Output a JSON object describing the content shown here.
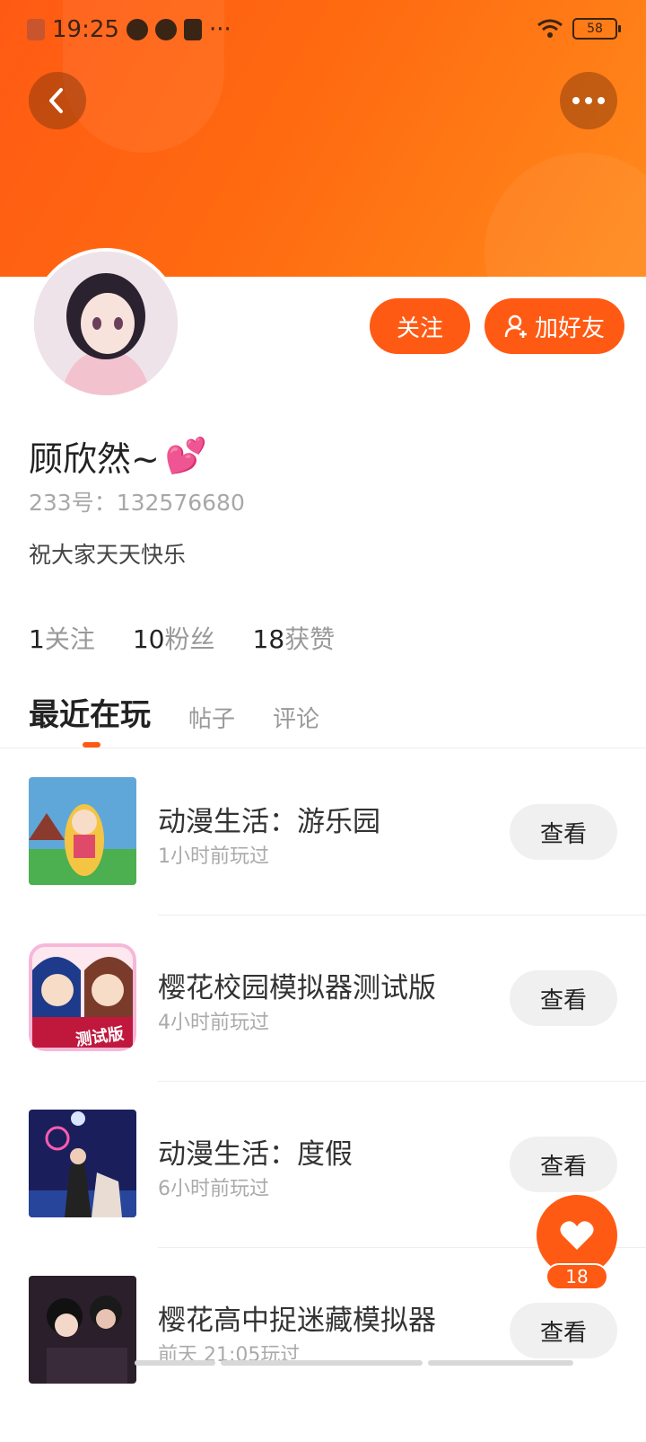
{
  "status_bar": {
    "time": "19:25",
    "ellipsis": "···",
    "battery": "58"
  },
  "profile": {
    "name": "顾欣然~",
    "name_emoji": "💕",
    "id_text": "233号：132576680",
    "bio": "祝大家天天快乐",
    "follow_label": "关注",
    "add_friend_label": "加好友"
  },
  "stats": [
    {
      "num": "1",
      "label": "关注"
    },
    {
      "num": "10",
      "label": "粉丝"
    },
    {
      "num": "18",
      "label": "获赞"
    }
  ],
  "tabs": [
    {
      "label": "最近在玩",
      "active": true
    },
    {
      "label": "帖子",
      "active": false
    },
    {
      "label": "评论",
      "active": false
    }
  ],
  "games": [
    {
      "title": "动漫生活：游乐园",
      "time": "1小时前玩过",
      "button": "查看"
    },
    {
      "title": "樱花校园模拟器测试版",
      "time": "4小时前玩过",
      "button": "查看",
      "icon_badge": "测试版"
    },
    {
      "title": "动漫生活：度假",
      "time": "6小时前玩过",
      "button": "查看"
    },
    {
      "title": "樱花高中捉迷藏模拟器",
      "time": "前天 21:05玩过",
      "button": "查看"
    }
  ],
  "like_count": "18",
  "colors": {
    "accent": "#ff5a14",
    "header_gradient_end": "#ff8a1c"
  }
}
